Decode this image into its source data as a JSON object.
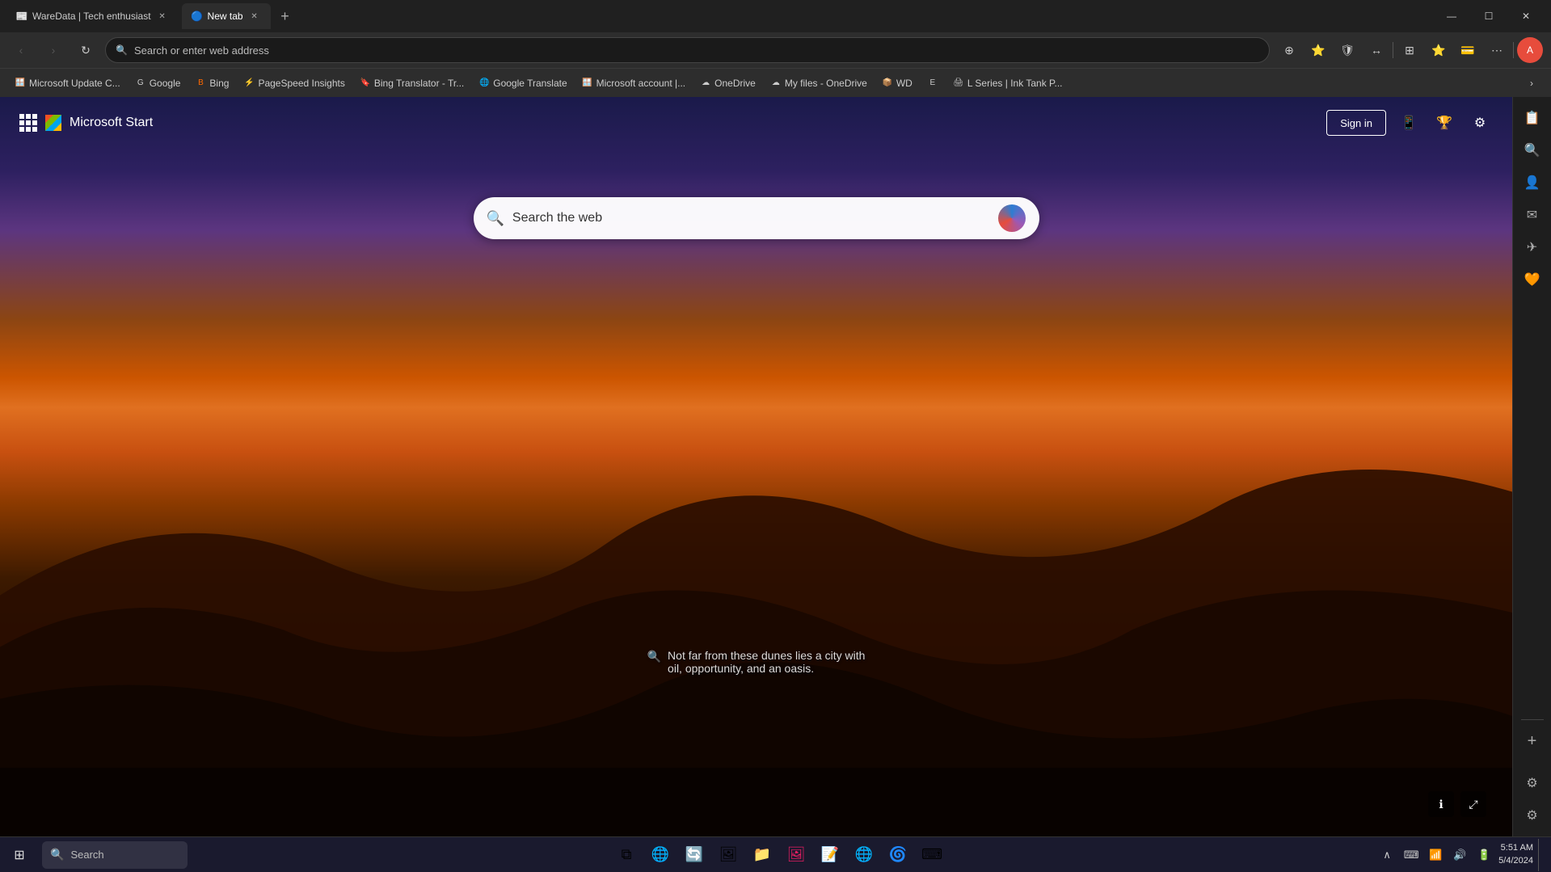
{
  "browser": {
    "tabs": [
      {
        "id": "tab1",
        "label": "WareData | Tech enthusiast",
        "active": false,
        "favicon": "📰"
      },
      {
        "id": "tab2",
        "label": "New tab",
        "active": true,
        "favicon": "🔵"
      }
    ],
    "new_tab_label": "+",
    "window_controls": {
      "minimize": "—",
      "maximize": "☐",
      "close": "✕"
    }
  },
  "navbar": {
    "back_label": "‹",
    "forward_label": "›",
    "refresh_label": "↻",
    "address_placeholder": "Search or enter web address",
    "actions": [
      "🔖",
      "⭐",
      "🛡",
      "↔",
      "⊞",
      "⭐+",
      "👤",
      "⋯"
    ]
  },
  "bookmarks": [
    {
      "id": "bk1",
      "label": "Microsoft Update C...",
      "favicon": "🪟"
    },
    {
      "id": "bk2",
      "label": "Google",
      "favicon": "G"
    },
    {
      "id": "bk3",
      "label": "Bing",
      "favicon": "B"
    },
    {
      "id": "bk4",
      "label": "PageSpeed Insights",
      "favicon": "⚡"
    },
    {
      "id": "bk5",
      "label": "Bing Translator - Tr...",
      "favicon": "🔖"
    },
    {
      "id": "bk6",
      "label": "Google Translate",
      "favicon": "🌐"
    },
    {
      "id": "bk7",
      "label": "Microsoft account |...",
      "favicon": "🪟"
    },
    {
      "id": "bk8",
      "label": "OneDrive",
      "favicon": "☁"
    },
    {
      "id": "bk9",
      "label": "My files - OneDrive",
      "favicon": "☁"
    },
    {
      "id": "bk10",
      "label": "WD",
      "favicon": "📦"
    },
    {
      "id": "bk11",
      "label": "E",
      "favicon": "E"
    },
    {
      "id": "bk12",
      "label": "L Series | Ink Tank P...",
      "favicon": "🖨"
    }
  ],
  "page": {
    "title": "Microsoft Start",
    "sign_in_label": "Sign in",
    "search_placeholder": "Search the web",
    "image_caption_line1": "Not far from these dunes lies a city with",
    "image_caption_line2": "oil, opportunity, and an oasis."
  },
  "right_sidebar": {
    "icons": [
      "📋",
      "👤",
      "🔍",
      "📧",
      "✈",
      "🧡"
    ]
  },
  "taskbar": {
    "search_label": "Search",
    "time": "5:51 AM",
    "date": "5/4/2024",
    "taskbar_icons": [
      {
        "id": "windows",
        "symbol": "⊞"
      },
      {
        "id": "search",
        "symbol": "🔍"
      },
      {
        "id": "task-view",
        "symbol": "⧉"
      },
      {
        "id": "edge-browser",
        "symbol": "🌐"
      },
      {
        "id": "edge2",
        "symbol": "🔄"
      },
      {
        "id": "gallery",
        "symbol": "🖼"
      },
      {
        "id": "file-explorer",
        "symbol": "📁"
      },
      {
        "id": "photos",
        "symbol": "🖼"
      },
      {
        "id": "notepad",
        "symbol": "📝"
      },
      {
        "id": "browser1",
        "symbol": "🌐"
      },
      {
        "id": "browser2",
        "symbol": "🌀"
      },
      {
        "id": "terminal",
        "symbol": "⌨"
      }
    ]
  }
}
